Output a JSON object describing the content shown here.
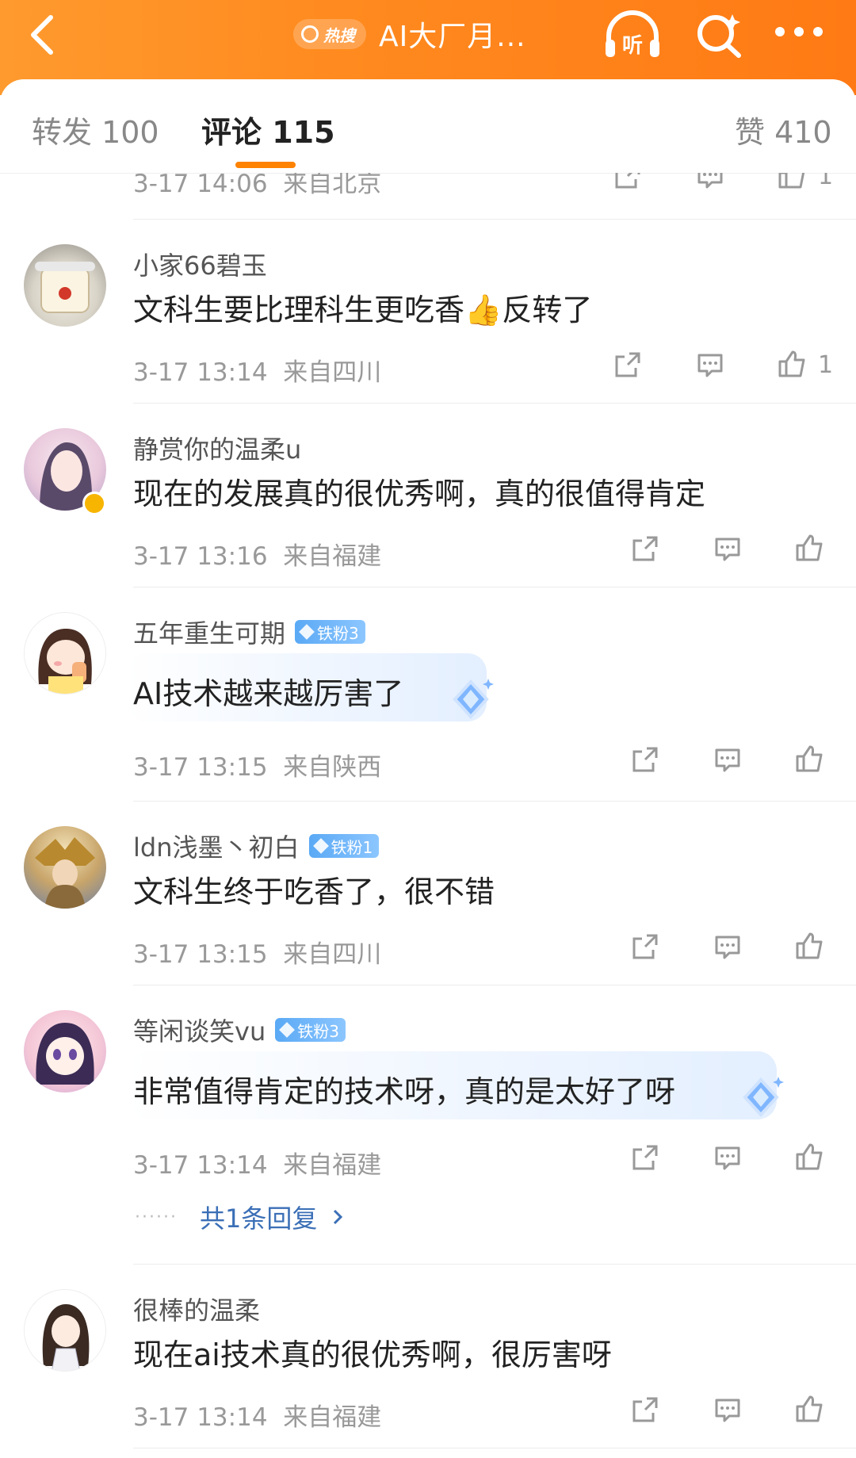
{
  "header": {
    "hot_label": "热搜",
    "title": "AI大厂月...",
    "listen_label": "听"
  },
  "tabs": [
    {
      "label": "转发 100"
    },
    {
      "label": "评论 115"
    },
    {
      "label": "赞 410"
    }
  ],
  "partial_meta": {
    "time": "3-17 14:06",
    "location": "来自北京",
    "likes": "1"
  },
  "comments": [
    {
      "user": "小家66碧玉",
      "badge": "",
      "text": "文科生要比理科生更吃香👍反转了",
      "time": "3-17 13:14",
      "location": "来自四川",
      "likes": "1"
    },
    {
      "user": "静赏你的温柔u",
      "badge": "",
      "text": "现在的发展真的很优秀啊，真的很值得肯定",
      "time": "3-17 13:16",
      "location": "来自福建",
      "likes": ""
    },
    {
      "user": "五年重生可期",
      "badge": "铁粉3",
      "text": "AI技术越来越厉害了",
      "time": "3-17 13:15",
      "location": "来自陕西",
      "likes": ""
    },
    {
      "user": "ldn浅墨丶初白",
      "badge": "铁粉1",
      "text": "文科生终于吃香了，很不错",
      "time": "3-17 13:15",
      "location": "来自四川",
      "likes": ""
    },
    {
      "user": "等闲谈笑vu",
      "badge": "铁粉3",
      "text": "非常值得肯定的技术呀，真的是太好了呀",
      "time": "3-17 13:14",
      "location": "来自福建",
      "likes": "",
      "reply_link": "共1条回复"
    },
    {
      "user": "很棒的温柔",
      "badge": "",
      "text": "现在ai技术真的很优秀啊，很厉害呀",
      "time": "3-17 13:14",
      "location": "来自福建",
      "likes": ""
    }
  ]
}
